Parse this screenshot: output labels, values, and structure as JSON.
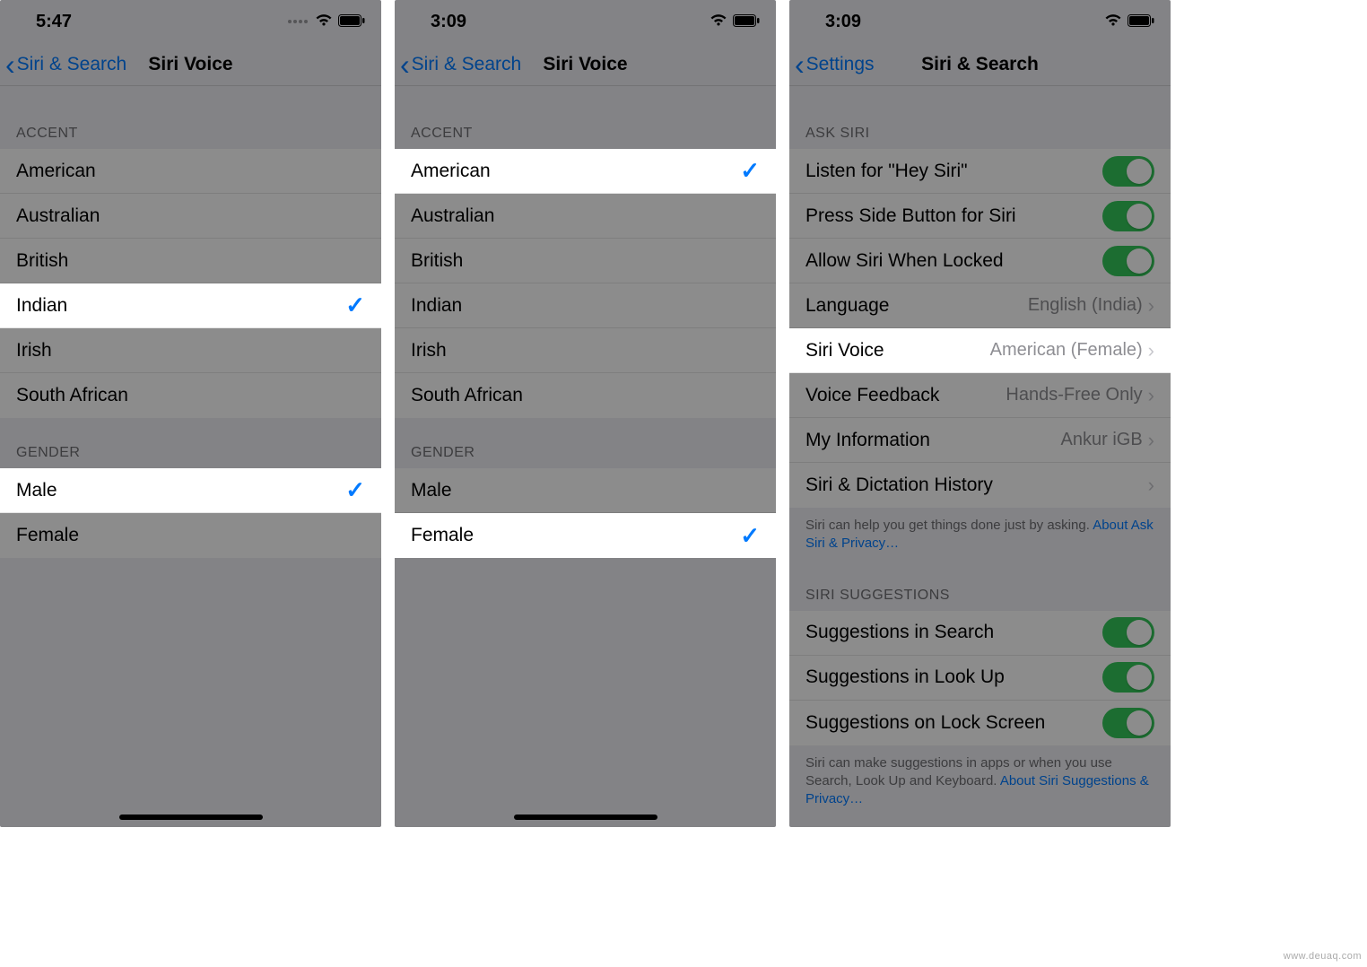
{
  "watermark": "www.deuaq.com",
  "panel1": {
    "time": "5:47",
    "back": "Siri & Search",
    "title": "Siri Voice",
    "accent_header": "ACCENT",
    "accents": [
      "American",
      "Australian",
      "British",
      "Indian",
      "Irish",
      "South African"
    ],
    "accent_selected": "Indian",
    "gender_header": "GENDER",
    "genders": [
      "Male",
      "Female"
    ],
    "gender_selected": "Male"
  },
  "panel2": {
    "time": "3:09",
    "back": "Siri & Search",
    "title": "Siri Voice",
    "accent_header": "ACCENT",
    "accents": [
      "American",
      "Australian",
      "British",
      "Indian",
      "Irish",
      "South African"
    ],
    "accent_selected": "American",
    "gender_header": "GENDER",
    "genders": [
      "Male",
      "Female"
    ],
    "gender_selected": "Female"
  },
  "panel3": {
    "time": "3:09",
    "back": "Settings",
    "title": "Siri & Search",
    "ask_header": "ASK SIRI",
    "rows": {
      "hey_siri": "Listen for \"Hey Siri\"",
      "side_button": "Press Side Button for Siri",
      "allow_locked": "Allow Siri When Locked",
      "language_label": "Language",
      "language_value": "English (India)",
      "siri_voice_label": "Siri Voice",
      "siri_voice_value": "American (Female)",
      "voice_feedback_label": "Voice Feedback",
      "voice_feedback_value": "Hands-Free Only",
      "my_info_label": "My Information",
      "my_info_value": "Ankur iGB",
      "history_label": "Siri & Dictation History"
    },
    "ask_footer_text": "Siri can help you get things done just by asking. ",
    "ask_footer_link": "About Ask Siri & Privacy…",
    "suggestions_header": "SIRI SUGGESTIONS",
    "sugg": {
      "search": "Suggestions in Search",
      "lookup": "Suggestions in Look Up",
      "lock": "Suggestions on Lock Screen"
    },
    "sugg_footer_text": "Siri can make suggestions in apps or when you use Search, Look Up and Keyboard. ",
    "sugg_footer_link": "About Siri Suggestions & Privacy…"
  }
}
